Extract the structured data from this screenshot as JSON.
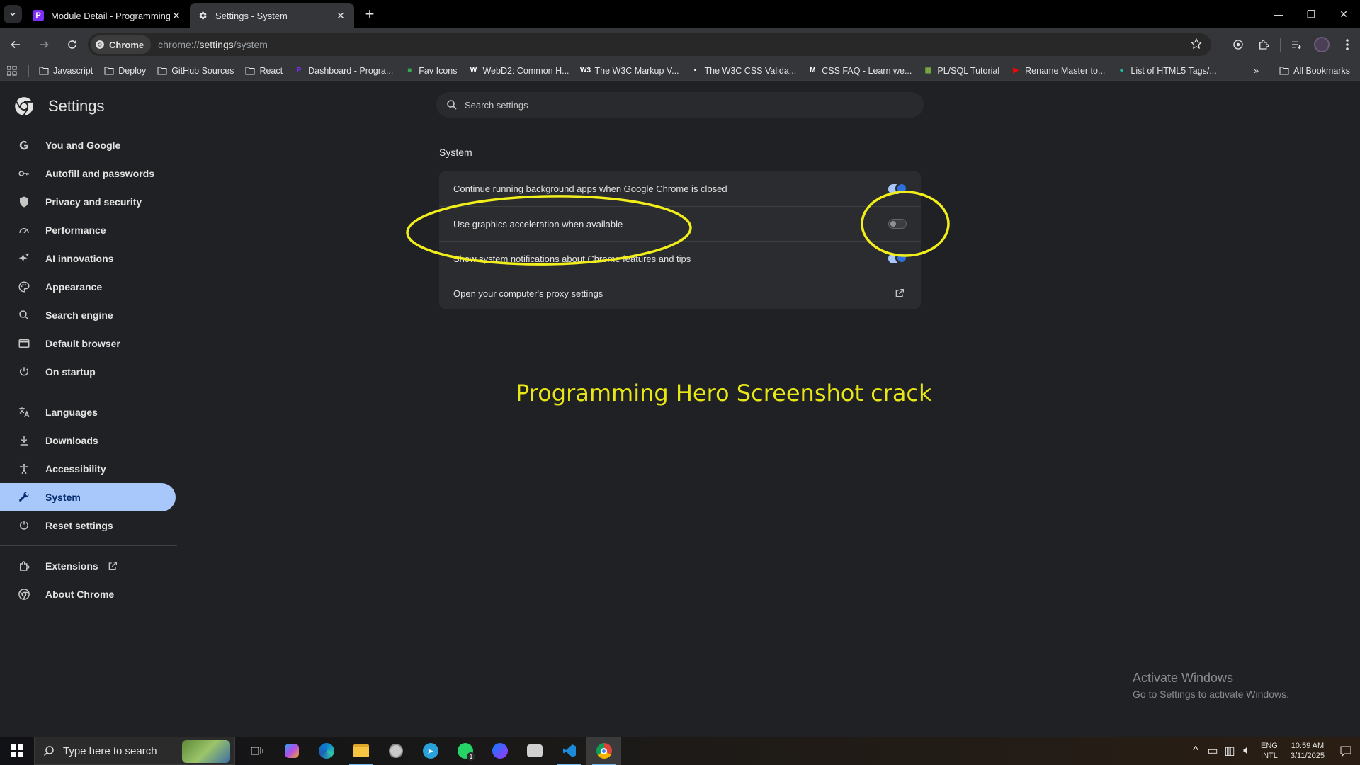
{
  "tabs": [
    {
      "title": "Module Detail - Programming Hero",
      "favicon_color": "#7b2ff7",
      "favicon_letter": "P"
    },
    {
      "title": "Settings - System"
    }
  ],
  "toolbar": {
    "chip_label": "Chrome",
    "url_prefix": "chrome://",
    "url_bold": "settings",
    "url_suffix": "/system"
  },
  "bookmarks": [
    {
      "label": "Javascript",
      "icon": "folder-icon"
    },
    {
      "label": "Deploy",
      "icon": "folder-icon"
    },
    {
      "label": "GitHub Sources",
      "icon": "folder-icon"
    },
    {
      "label": "React",
      "icon": "folder-icon"
    },
    {
      "label": "Dashboard - Progra...",
      "icon": "P",
      "color": "#7b2ff7"
    },
    {
      "label": "Fav Icons",
      "icon": "■",
      "color": "#34a853"
    },
    {
      "label": "WebD2: Common H...",
      "icon": "W",
      "color": "#ffffff"
    },
    {
      "label": "The W3C Markup V...",
      "icon": "W3",
      "color": "#ffffff"
    },
    {
      "label": "The W3C CSS Valida...",
      "icon": "▪",
      "color": "#ffffff"
    },
    {
      "label": "CSS FAQ - Learn we...",
      "icon": "M",
      "color": "#ffffff"
    },
    {
      "label": "PL/SQL Tutorial",
      "icon": "▦",
      "color": "#7cb342"
    },
    {
      "label": "Rename Master to...",
      "icon": "▶",
      "color": "#ff0000"
    },
    {
      "label": "List of HTML5 Tags/...",
      "icon": "●",
      "color": "#1abc9c"
    }
  ],
  "all_bookmarks": "All Bookmarks",
  "settings": {
    "title": "Settings",
    "search_placeholder": "Search settings",
    "nav": [
      {
        "label": "You and Google",
        "icon": "google-icon"
      },
      {
        "label": "Autofill and passwords",
        "icon": "key-icon"
      },
      {
        "label": "Privacy and security",
        "icon": "shield-icon"
      },
      {
        "label": "Performance",
        "icon": "speedometer-icon"
      },
      {
        "label": "AI innovations",
        "icon": "sparkle-icon"
      },
      {
        "label": "Appearance",
        "icon": "palette-icon"
      },
      {
        "label": "Search engine",
        "icon": "search-icon"
      },
      {
        "label": "Default browser",
        "icon": "browser-icon"
      },
      {
        "label": "On startup",
        "icon": "power-icon"
      }
    ],
    "nav2": [
      {
        "label": "Languages",
        "icon": "translate-icon"
      },
      {
        "label": "Downloads",
        "icon": "download-icon"
      },
      {
        "label": "Accessibility",
        "icon": "accessibility-icon"
      },
      {
        "label": "System",
        "icon": "wrench-icon",
        "selected": true
      },
      {
        "label": "Reset settings",
        "icon": "reset-icon"
      }
    ],
    "nav3": [
      {
        "label": "Extensions",
        "icon": "puzzle-icon"
      },
      {
        "label": "About Chrome",
        "icon": "chrome-icon"
      }
    ],
    "section_title": "System",
    "rows": [
      {
        "label": "Continue running background apps when Google Chrome is closed",
        "type": "toggle",
        "on": true
      },
      {
        "label": "Use graphics acceleration when available",
        "type": "toggle",
        "on": false
      },
      {
        "label": "Show system notifications about Chrome features and tips",
        "type": "toggle",
        "on": true
      },
      {
        "label": "Open your computer's proxy settings",
        "type": "link"
      }
    ]
  },
  "overlay_text": "Programming Hero Screenshot crack",
  "annotation_color": "#f0ee1b",
  "activate": {
    "line1": "Activate Windows",
    "line2": "Go to Settings to activate Windows."
  },
  "taskbar": {
    "search_placeholder": "Type here to search",
    "lang_line1": "ENG",
    "lang_line2": "INTL",
    "time": "10:59 AM",
    "date": "3/11/2025",
    "whatsapp_badge": "1"
  }
}
